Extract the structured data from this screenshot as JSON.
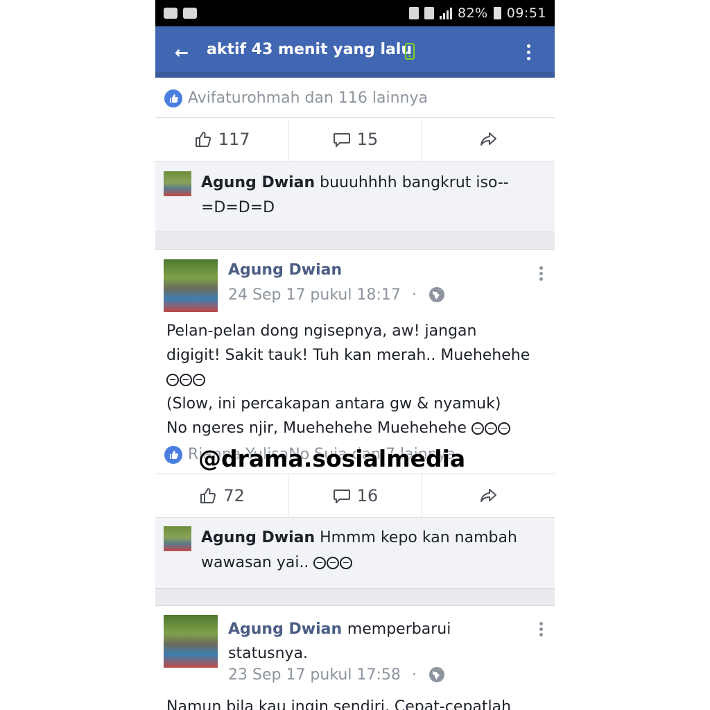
{
  "status_bar": {
    "battery": "82%",
    "time": "09:51"
  },
  "header": {
    "title": "aktif 43 menit yang lalu"
  },
  "post1": {
    "likes_summary": "Avifaturohmah dan 116 lainnya",
    "like_count": "117",
    "comment_count": "15",
    "comment": {
      "author": "Agung Dwian",
      "text": "buuuhhhh bangkrut iso--",
      "text2": "=D=D=D"
    }
  },
  "post2": {
    "author": "Agung Dwian",
    "date": "24 Sep 17 pukul 18:17",
    "dot": "·",
    "body_lines": [
      "Pelan-pelan dong ngisepnya, aw! jangan",
      "digigit! Sakit tauk! Tuh kan merah.. Muehehehe",
      "",
      "(Slow, ini percakapan antara gw & nyamuk)",
      "No ngeres njir,  Muehehehe Muehehehe"
    ],
    "likes_summary": "Rianna YulisaNo Suia dan 7 lainnya",
    "like_count": "72",
    "comment_count": "16",
    "comment": {
      "author": "Agung Dwian",
      "text": "Hmmm kepo kan nambah",
      "text2": "wawasan yai.."
    }
  },
  "post3": {
    "author": "Agung Dwian",
    "verb": "memperbarui",
    "verb2": "statusnya.",
    "date": "23 Sep 17 pukul 17:58",
    "dot": "·",
    "body_line": "Namun bila kau ingin sendiri, Cepat-cepatlah"
  },
  "watermark": "@drama.sosialmedia",
  "colors": {
    "header": "#4267b2",
    "link_name": "#4b5d85",
    "muted": "#8d949e"
  }
}
